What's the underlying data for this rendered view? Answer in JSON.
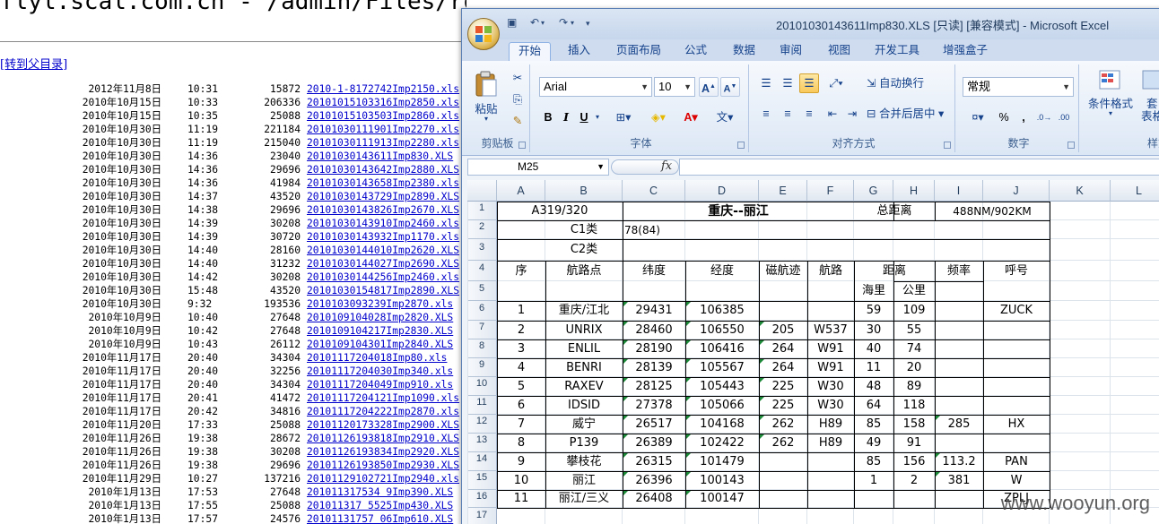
{
  "directory": {
    "title": "flyl.scal.com.cn - /admin/Files/routecar/",
    "parent_link": "[转到父目录]",
    "rows": [
      {
        "date": "2012年11月8日",
        "time": "10:31",
        "size": "15872",
        "name": "2010-1-8172742Imp2150.xls"
      },
      {
        "date": "2010年10月15日",
        "time": "10:33",
        "size": "206336",
        "name": "20101015103316Imp2850.xls"
      },
      {
        "date": "2010年10月15日",
        "time": "10:35",
        "size": "25088",
        "name": "20101015103503Imp2860.xls"
      },
      {
        "date": "2010年10月30日",
        "time": "11:19",
        "size": "221184",
        "name": "20101030111901Imp2270.xls"
      },
      {
        "date": "2010年10月30日",
        "time": "11:19",
        "size": "215040",
        "name": "20101030111913Imp2280.xls"
      },
      {
        "date": "2010年10月30日",
        "time": "14:36",
        "size": "23040",
        "name": "20101030143611Imp830.XLS"
      },
      {
        "date": "2010年10月30日",
        "time": "14:36",
        "size": "29696",
        "name": "20101030143642Imp2880.XLS"
      },
      {
        "date": "2010年10月30日",
        "time": "14:36",
        "size": "41984",
        "name": "20101030143658Imp2380.xls"
      },
      {
        "date": "2010年10月30日",
        "time": "14:37",
        "size": "43520",
        "name": "20101030143729Imp2890.XLS"
      },
      {
        "date": "2010年10月30日",
        "time": "14:38",
        "size": "29696",
        "name": "20101030143826Imp2670.XLS"
      },
      {
        "date": "2010年10月30日",
        "time": "14:39",
        "size": "30208",
        "name": "20101030143910Imp2460.xls"
      },
      {
        "date": "2010年10月30日",
        "time": "14:39",
        "size": "30720",
        "name": "20101030143932Imp1170.xls"
      },
      {
        "date": "2010年10月30日",
        "time": "14:40",
        "size": "28160",
        "name": "20101030144010Imp2620.XLS"
      },
      {
        "date": "2010年10月30日",
        "time": "14:40",
        "size": "31232",
        "name": "20101030144027Imp2690.XLS"
      },
      {
        "date": "2010年10月30日",
        "time": "14:42",
        "size": "30208",
        "name": "20101030144256Imp2460.xls"
      },
      {
        "date": "2010年10月30日",
        "time": "15:48",
        "size": "43520",
        "name": "20101030154817Imp2890.XLS"
      },
      {
        "date": "2010年10月30日",
        "time": "9:32",
        "size": "193536",
        "name": "2010103093239Imp2870.xls"
      },
      {
        "date": "2010年10月9日",
        "time": "10:40",
        "size": "27648",
        "name": "2010109104028Imp2820.XLS"
      },
      {
        "date": "2010年10月9日",
        "time": "10:42",
        "size": "27648",
        "name": "2010109104217Imp2830.XLS"
      },
      {
        "date": "2010年10月9日",
        "time": "10:43",
        "size": "26112",
        "name": "2010109104301Imp2840.XLS"
      },
      {
        "date": "2010年11月17日",
        "time": "20:40",
        "size": "34304",
        "name": "20101117204018Imp80.xls"
      },
      {
        "date": "2010年11月17日",
        "time": "20:40",
        "size": "32256",
        "name": "20101117204030Imp340.xls"
      },
      {
        "date": "2010年11月17日",
        "time": "20:40",
        "size": "34304",
        "name": "20101117204049Imp910.xls"
      },
      {
        "date": "2010年11月17日",
        "time": "20:41",
        "size": "41472",
        "name": "20101117204121Imp1090.xls"
      },
      {
        "date": "2010年11月17日",
        "time": "20:42",
        "size": "34816",
        "name": "20101117204222Imp2870.xls"
      },
      {
        "date": "2010年11月20日",
        "time": "17:33",
        "size": "25088",
        "name": "20101120173328Imp2900.XLS"
      },
      {
        "date": "2010年11月26日",
        "time": "19:38",
        "size": "28672",
        "name": "20101126193818Imp2910.XLS"
      },
      {
        "date": "2010年11月26日",
        "time": "19:38",
        "size": "30208",
        "name": "20101126193834Imp2920.XLS"
      },
      {
        "date": "2010年11月26日",
        "time": "19:38",
        "size": "29696",
        "name": "20101126193850Imp2930.XLS"
      },
      {
        "date": "2010年11月29日",
        "time": "10:27",
        "size": "137216",
        "name": "20101129102721Imp2940.xls"
      },
      {
        "date": "2010年1月13日",
        "time": "17:53",
        "size": "27648",
        "name": "201011317534 9Imp390.XLS"
      },
      {
        "date": "2010年1月13日",
        "time": "17:55",
        "size": "25088",
        "name": "201011317 5525Imp430.XLS"
      },
      {
        "date": "2010年1月13日",
        "time": "17:57",
        "size": "24576",
        "name": "20101131757 06Imp610.XLS"
      }
    ]
  },
  "excel": {
    "title": "20101030143611Imp830.XLS  [只读]  [兼容模式] - Microsoft Excel",
    "tabs": [
      "开始",
      "插入",
      "页面布局",
      "公式",
      "数据",
      "审阅",
      "视图",
      "开发工具",
      "增强盒子"
    ],
    "ribbon": {
      "paste": "粘贴",
      "clipboard_label": "剪贴板",
      "font_name": "Arial",
      "font_size": "10",
      "font_label": "字体",
      "wrap_text": "自动换行",
      "merge_center": "合并后居中",
      "align_label": "对齐方式",
      "number_format": "常规",
      "number_label": "数字",
      "cond_format": "条件格式",
      "table_format_a": "套",
      "table_format_b": "表格格",
      "style_label": "样式"
    },
    "name_box": "M25",
    "fx": "fx",
    "columns": [
      "A",
      "B",
      "C",
      "D",
      "E",
      "F",
      "G",
      "H",
      "I",
      "J",
      "K",
      "L"
    ],
    "rows": [
      "1",
      "2",
      "3",
      "4",
      "5",
      "6",
      "7",
      "8",
      "9",
      "10",
      "11",
      "12",
      "13",
      "14",
      "15",
      "16",
      "17"
    ],
    "sheet": {
      "a1": "A319/320",
      "title": "重庆--丽江",
      "total_label": "总距离",
      "total_value": "488NM/902KM",
      "c1_label": "C1类",
      "c1_value": "78(84)",
      "c2_label": "C2类",
      "headers": {
        "seq": "序",
        "point": "航路点",
        "lat": "纬度",
        "lon": "经度",
        "mag": "磁航迹",
        "route": "航路",
        "dist": "距离",
        "nm": "海里",
        "km": "公里",
        "freq": "频率",
        "call": "呼号"
      },
      "data": [
        {
          "seq": "1",
          "point": "重庆/江北",
          "lat": "29431",
          "lon": "106385",
          "mag": "",
          "route": "",
          "nm": "59",
          "km": "109",
          "freq": "",
          "call": "ZUCK"
        },
        {
          "seq": "2",
          "point": "UNRIX",
          "lat": "28460",
          "lon": "106550",
          "mag": "205",
          "route": "W537",
          "nm": "30",
          "km": "55",
          "freq": "",
          "call": ""
        },
        {
          "seq": "3",
          "point": "ENLIL",
          "lat": "28190",
          "lon": "106416",
          "mag": "264",
          "route": "W91",
          "nm": "40",
          "km": "74",
          "freq": "",
          "call": ""
        },
        {
          "seq": "4",
          "point": "BENRI",
          "lat": "28139",
          "lon": "105567",
          "mag": "264",
          "route": "W91",
          "nm": "11",
          "km": "20",
          "freq": "",
          "call": ""
        },
        {
          "seq": "5",
          "point": "RAXEV",
          "lat": "28125",
          "lon": "105443",
          "mag": "225",
          "route": "W30",
          "nm": "48",
          "km": "89",
          "freq": "",
          "call": ""
        },
        {
          "seq": "6",
          "point": "IDSID",
          "lat": "27378",
          "lon": "105066",
          "mag": "225",
          "route": "W30",
          "nm": "64",
          "km": "118",
          "freq": "",
          "call": ""
        },
        {
          "seq": "7",
          "point": "威宁",
          "lat": "26517",
          "lon": "104168",
          "mag": "262",
          "route": "H89",
          "nm": "85",
          "km": "158",
          "freq": "285",
          "call": "HX"
        },
        {
          "seq": "8",
          "point": "P139",
          "lat": "26389",
          "lon": "102422",
          "mag": "262",
          "route": "H89",
          "nm": "49",
          "km": "91",
          "freq": "",
          "call": ""
        },
        {
          "seq": "9",
          "point": "攀枝花",
          "lat": "26315",
          "lon": "101479",
          "mag": "",
          "route": "",
          "nm": "85",
          "km": "156",
          "freq": "113.2",
          "call": "PAN"
        },
        {
          "seq": "10",
          "point": "丽江",
          "lat": "26396",
          "lon": "100143",
          "mag": "",
          "route": "",
          "nm": "1",
          "km": "2",
          "freq": "381",
          "call": "W"
        },
        {
          "seq": "11",
          "point": "丽江/三义",
          "lat": "26408",
          "lon": "100147",
          "mag": "",
          "route": "",
          "nm": "",
          "km": "",
          "freq": "",
          "call": "ZPLJ"
        }
      ]
    }
  },
  "watermark": "www.wooyun.org"
}
